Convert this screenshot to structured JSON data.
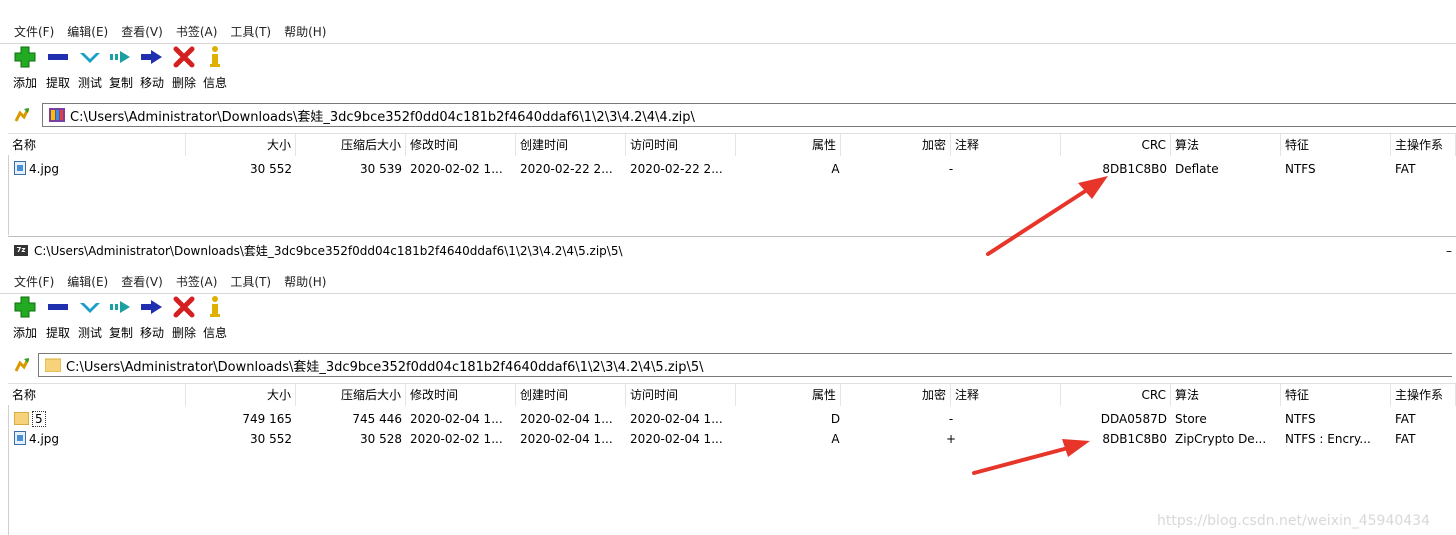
{
  "menu": [
    "文件(F)",
    "编辑(E)",
    "查看(V)",
    "书签(A)",
    "工具(T)",
    "帮助(H)"
  ],
  "toolbar": {
    "add": "添加",
    "extract": "提取",
    "test": "测试",
    "copy": "复制",
    "move": "移动",
    "delete": "删除",
    "info": "信息"
  },
  "columns": {
    "name": "名称",
    "size": "大小",
    "packed": "压缩后大小",
    "modified": "修改时间",
    "created": "创建时间",
    "accessed": "访问时间",
    "attributes": "属性",
    "encrypted": "加密",
    "comment": "注释",
    "crc": "CRC",
    "method": "算法",
    "characteristics": "特征",
    "host_os": "主操作系"
  },
  "pane1": {
    "path": "C:\\Users\\Administrator\\Downloads\\套娃_3dc9bce352f0dd04c181b2f4640ddaf6\\1\\2\\3\\4.2\\4\\4.zip\\",
    "rows": [
      {
        "name": "4.jpg",
        "size": "30 552",
        "packed": "30 539",
        "modified": "2020-02-02 1...",
        "created": "2020-02-22 2...",
        "accessed": "2020-02-22 2...",
        "attributes": "A",
        "encrypted": "-",
        "comment": "",
        "crc": "8DB1C8B0",
        "method": "Deflate",
        "characteristics": "NTFS",
        "host_os": "FAT"
      }
    ]
  },
  "pane2": {
    "title": "C:\\Users\\Administrator\\Downloads\\套娃_3dc9bce352f0dd04c181b2f4640ddaf6\\1\\2\\3\\4.2\\4\\5.zip\\5\\",
    "path": "C:\\Users\\Administrator\\Downloads\\套娃_3dc9bce352f0dd04c181b2f4640ddaf6\\1\\2\\3\\4.2\\4\\5.zip\\5\\",
    "rows": [
      {
        "name": "5",
        "size": "749 165",
        "packed": "745 446",
        "modified": "2020-02-04 1...",
        "created": "2020-02-04 1...",
        "accessed": "2020-02-04 1...",
        "attributes": "D",
        "encrypted": "-",
        "comment": "",
        "crc": "DDA0587D",
        "method": "Store",
        "characteristics": "NTFS",
        "host_os": "FAT"
      },
      {
        "name": "4.jpg",
        "size": "30 552",
        "packed": "30 528",
        "modified": "2020-02-02 1...",
        "created": "2020-02-04 1...",
        "accessed": "2020-02-04 1...",
        "attributes": "A",
        "encrypted": "+",
        "comment": "",
        "crc": "8DB1C8B0",
        "method": "ZipCrypto De...",
        "characteristics": "NTFS : Encry...",
        "host_os": "FAT"
      }
    ]
  },
  "watermark": "https://blog.csdn.net/weixin_45940434",
  "colors": {
    "arrow": "#e8352a",
    "add": "#22aa22",
    "extract": "#1f2fb0",
    "test": "#1aa0c8",
    "delete": "#d42020",
    "info": "#e0b000"
  }
}
